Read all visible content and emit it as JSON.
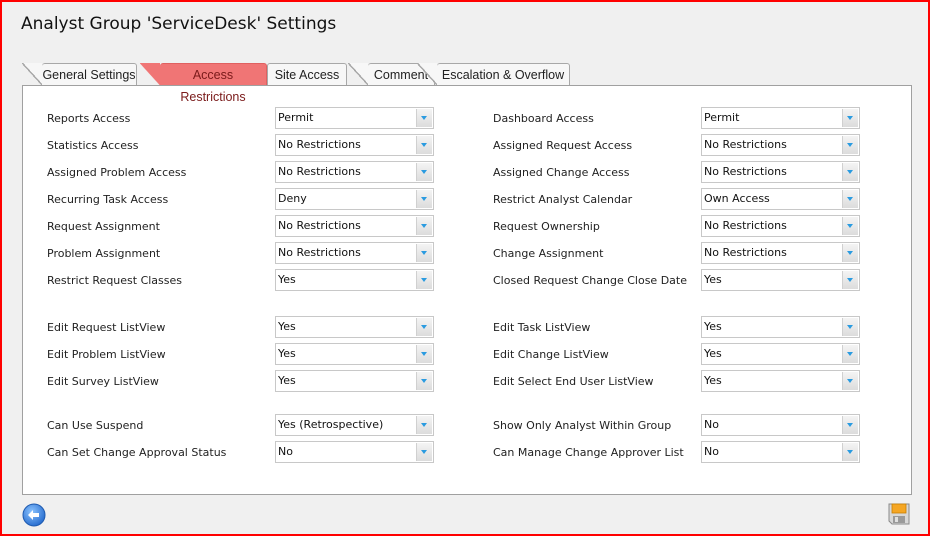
{
  "window": {
    "title": "Analyst Group 'ServiceDesk' Settings"
  },
  "tabs": [
    {
      "label": "General Settings",
      "active": false
    },
    {
      "label": "Access Restrictions",
      "active": true
    },
    {
      "label": "Site Access",
      "active": false
    },
    {
      "label": "Comment",
      "active": false
    },
    {
      "label": "Escalation & Overflow",
      "active": false
    }
  ],
  "left_fields": [
    {
      "label": "Reports Access",
      "value": "Permit"
    },
    {
      "label": "Statistics Access",
      "value": "No Restrictions"
    },
    {
      "label": "Assigned Problem Access",
      "value": "No Restrictions"
    },
    {
      "label": "Recurring Task Access",
      "value": "Deny"
    },
    {
      "label": "Request Assignment",
      "value": "No Restrictions"
    },
    {
      "label": "Problem Assignment",
      "value": "No Restrictions"
    },
    {
      "label": "Restrict Request Classes",
      "value": "Yes"
    },
    {
      "label": "Edit Request ListView",
      "value": "Yes"
    },
    {
      "label": "Edit Problem ListView",
      "value": "Yes"
    },
    {
      "label": "Edit Survey ListView",
      "value": "Yes"
    },
    {
      "label": "Can Use Suspend",
      "value": "Yes (Retrospective)"
    },
    {
      "label": "Can Set Change Approval Status",
      "value": "No"
    }
  ],
  "right_fields": [
    {
      "label": "Dashboard Access",
      "value": "Permit"
    },
    {
      "label": "Assigned Request Access",
      "value": "No Restrictions"
    },
    {
      "label": "Assigned Change Access",
      "value": "No Restrictions"
    },
    {
      "label": "Restrict Analyst Calendar",
      "value": "Own Access"
    },
    {
      "label": "Request Ownership",
      "value": "No Restrictions"
    },
    {
      "label": "Change Assignment",
      "value": "No Restrictions"
    },
    {
      "label": "Closed Request Change Close Date",
      "value": "Yes"
    },
    {
      "label": "Edit Task ListView",
      "value": "Yes"
    },
    {
      "label": "Edit Change ListView",
      "value": "Yes"
    },
    {
      "label": "Edit Select End User ListView",
      "value": "Yes"
    },
    {
      "label": "Show Only Analyst Within Group",
      "value": "No"
    },
    {
      "label": "Can Manage Change Approver List",
      "value": "No"
    }
  ],
  "footer": {
    "back_icon": "back-arrow-icon",
    "save_icon": "floppy-disk-icon"
  },
  "colors": {
    "frame_border": "#ff0000",
    "active_tab": "#f07575",
    "dropdown_arrow": "#2a9be0"
  }
}
